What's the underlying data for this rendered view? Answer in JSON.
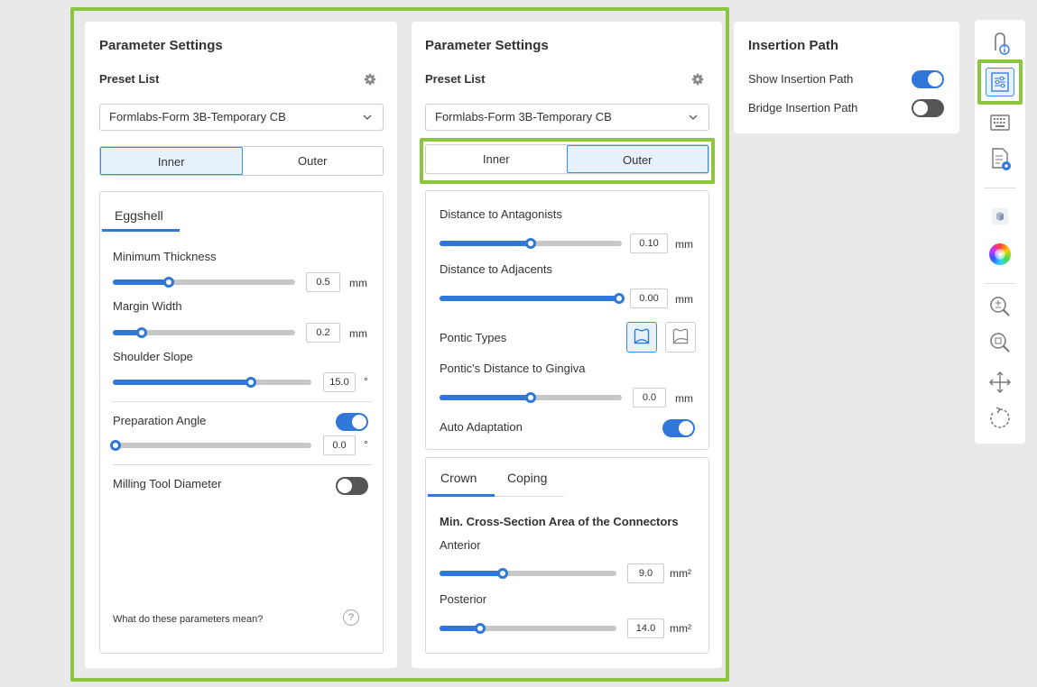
{
  "panel1": {
    "title": "Parameter Settings",
    "preset_label": "Preset List",
    "preset_value": "Formlabs-Form 3B-Temporary CB",
    "seg": [
      "Inner",
      "Outer"
    ],
    "tab": "Eggshell",
    "min_thickness": {
      "label": "Minimum Thickness",
      "value": "0.5",
      "unit": "mm",
      "level": 0.3
    },
    "margin_width": {
      "label": "Margin Width",
      "value": "0.2",
      "unit": "mm",
      "level": 0.15
    },
    "shoulder_slope": {
      "label": "Shoulder Slope",
      "value": "15.0",
      "unit": "°",
      "level": 0.7
    },
    "prep_angle": {
      "label": "Preparation Angle",
      "value": "0.0",
      "unit": "°",
      "level": 0.0
    },
    "milling": {
      "label": "Milling Tool Diameter"
    },
    "help": "What do these parameters mean?",
    "help_icon": "?"
  },
  "panel2": {
    "title": "Parameter Settings",
    "preset_label": "Preset List",
    "preset_value": "Formlabs-Form 3B-Temporary CB",
    "seg": [
      "Inner",
      "Outer"
    ],
    "dist_antagonists": {
      "label": "Distance to Antagonists",
      "value": "0.10",
      "unit": "mm",
      "level": 0.5
    },
    "dist_adjacents": {
      "label": "Distance to Adjacents",
      "value": "0.00",
      "unit": "mm",
      "level": 1.0
    },
    "pontic_types": "Pontic Types",
    "pontic_distance": {
      "label": "Pontic's Distance to Gingiva",
      "value": "0.0",
      "unit": "mm",
      "level": 0.5
    },
    "auto_adaptation": "Auto Adaptation",
    "tabs": [
      "Crown",
      "Coping"
    ],
    "connector_heading": "Min. Cross-Section Area of the Connectors",
    "anterior": {
      "label": "Anterior",
      "value": "9.0",
      "unit": "mm²",
      "level": 0.35
    },
    "posterior": {
      "label": "Posterior",
      "value": "14.0",
      "unit": "mm²",
      "level": 0.22
    }
  },
  "insertion": {
    "title": "Insertion Path",
    "show": "Show Insertion Path",
    "bridge": "Bridge Insertion Path"
  },
  "colors": {
    "accent": "#2f78d8",
    "highlight": "#8cc63f"
  }
}
